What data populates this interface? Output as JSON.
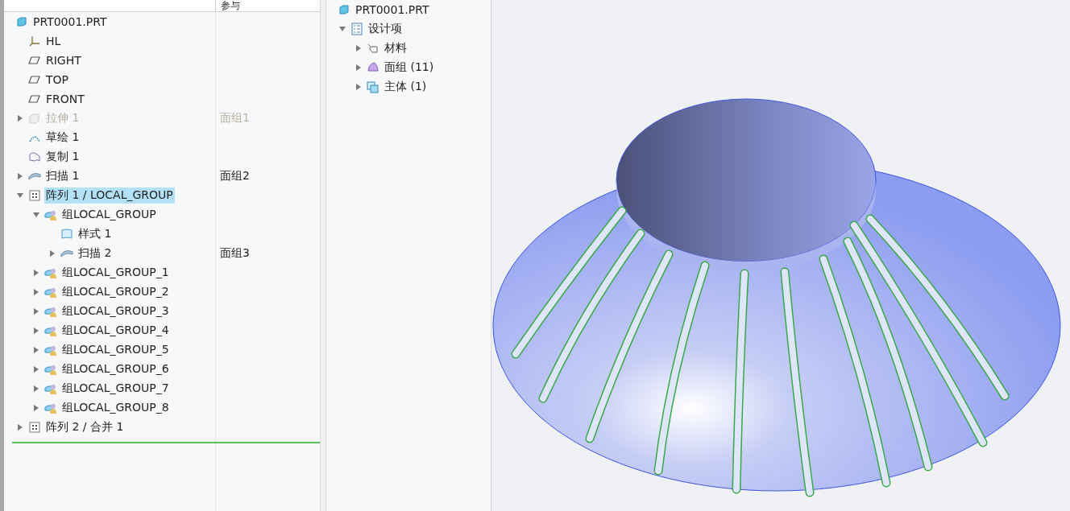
{
  "model_tree": {
    "column_header": "参与",
    "root": {
      "label": "PRT0001.PRT",
      "kind": "part",
      "selected": false,
      "children": [
        {
          "label": "HL",
          "kind": "csys",
          "selected": false
        },
        {
          "label": "RIGHT",
          "kind": "plane",
          "selected": false
        },
        {
          "label": "TOP",
          "kind": "plane",
          "selected": false
        },
        {
          "label": "FRONT",
          "kind": "plane",
          "selected": false
        },
        {
          "label": "拉伸 1",
          "kind": "extrude",
          "selected": false,
          "expanded": false,
          "disabled": true,
          "reference": "面组1"
        },
        {
          "label": "草绘 1",
          "kind": "sketch",
          "selected": false
        },
        {
          "label": "复制 1",
          "kind": "copy",
          "selected": false
        },
        {
          "label": "扫描 1",
          "kind": "sweep",
          "selected": false,
          "expanded": false,
          "reference": "面组2"
        },
        {
          "label": "阵列 1 / LOCAL_GROUP",
          "kind": "pattern",
          "selected": true,
          "expanded": true,
          "children": [
            {
              "label": "组LOCAL_GROUP",
              "kind": "group",
              "selected": false,
              "expanded": true,
              "children": [
                {
                  "label": "样式 1",
                  "kind": "style",
                  "selected": false
                },
                {
                  "label": "扫描 2",
                  "kind": "sweep",
                  "selected": false,
                  "expanded": false,
                  "reference": "面组3"
                }
              ]
            },
            {
              "label": "组LOCAL_GROUP_1",
              "kind": "group",
              "selected": false,
              "expanded": false
            },
            {
              "label": "组LOCAL_GROUP_2",
              "kind": "group",
              "selected": false,
              "expanded": false
            },
            {
              "label": "组LOCAL_GROUP_3",
              "kind": "group",
              "selected": false,
              "expanded": false
            },
            {
              "label": "组LOCAL_GROUP_4",
              "kind": "group",
              "selected": false,
              "expanded": false
            },
            {
              "label": "组LOCAL_GROUP_5",
              "kind": "group",
              "selected": false,
              "expanded": false
            },
            {
              "label": "组LOCAL_GROUP_6",
              "kind": "group",
              "selected": false,
              "expanded": false
            },
            {
              "label": "组LOCAL_GROUP_7",
              "kind": "group",
              "selected": false,
              "expanded": false
            },
            {
              "label": "组LOCAL_GROUP_8",
              "kind": "group",
              "selected": false,
              "expanded": false
            }
          ]
        },
        {
          "label": "阵列 2 / 合并 1",
          "kind": "pattern",
          "selected": false,
          "expanded": false
        }
      ]
    }
  },
  "detail_tree": {
    "root": {
      "label": "PRT0001.PRT",
      "kind": "part",
      "selected": false,
      "children": [
        {
          "label": "设计项",
          "kind": "list",
          "selected": false,
          "expanded": true,
          "children": [
            {
              "label": "材料",
              "kind": "material",
              "selected": false,
              "expanded": false
            },
            {
              "label": "面组 (11)",
              "kind": "quilt",
              "selected": false,
              "expanded": false
            },
            {
              "label": "主体 (1)",
              "kind": "body",
              "selected": false,
              "expanded": false
            }
          ]
        }
      ]
    }
  }
}
